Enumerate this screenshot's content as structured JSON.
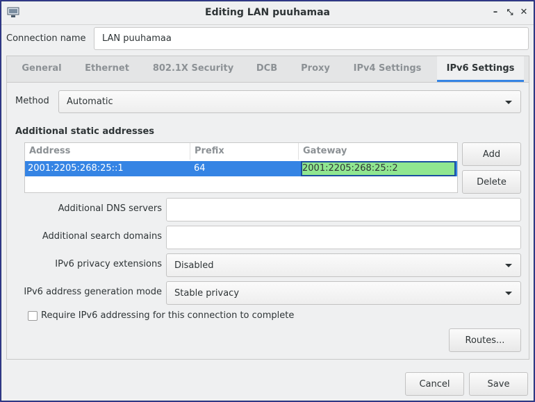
{
  "window": {
    "title": "Editing LAN puuhamaa"
  },
  "connection": {
    "name_label": "Connection name",
    "name_value": "LAN puuhamaa"
  },
  "tabs": [
    {
      "label": "General",
      "active": false
    },
    {
      "label": "Ethernet",
      "active": false
    },
    {
      "label": "802.1X Security",
      "active": false
    },
    {
      "label": "DCB",
      "active": false
    },
    {
      "label": "Proxy",
      "active": false
    },
    {
      "label": "IPv4 Settings",
      "active": false
    },
    {
      "label": "IPv6 Settings",
      "active": true
    }
  ],
  "ipv6": {
    "method_label": "Method",
    "method_value": "Automatic",
    "static_title": "Additional static addresses",
    "columns": [
      "Address",
      "Prefix",
      "Gateway"
    ],
    "rows": [
      {
        "address": "2001:2205:268:25::1",
        "prefix": "64",
        "gateway": "2001:2205:268:25::2"
      }
    ],
    "add_label": "Add",
    "delete_label": "Delete",
    "dns_label": "Additional DNS servers",
    "dns_value": "",
    "search_label": "Additional search domains",
    "search_value": "",
    "privacy_label": "IPv6 privacy extensions",
    "privacy_value": "Disabled",
    "genmode_label": "IPv6 address generation mode",
    "genmode_value": "Stable privacy",
    "require_label": "Require IPv6 addressing for this connection to complete",
    "require_checked": false,
    "routes_label": "Routes..."
  },
  "footer": {
    "cancel_label": "Cancel",
    "save_label": "Save"
  },
  "colors": {
    "selection": "#3584e4",
    "edit_cell": "#90e690",
    "active_tab_underline": "#3584e4"
  }
}
